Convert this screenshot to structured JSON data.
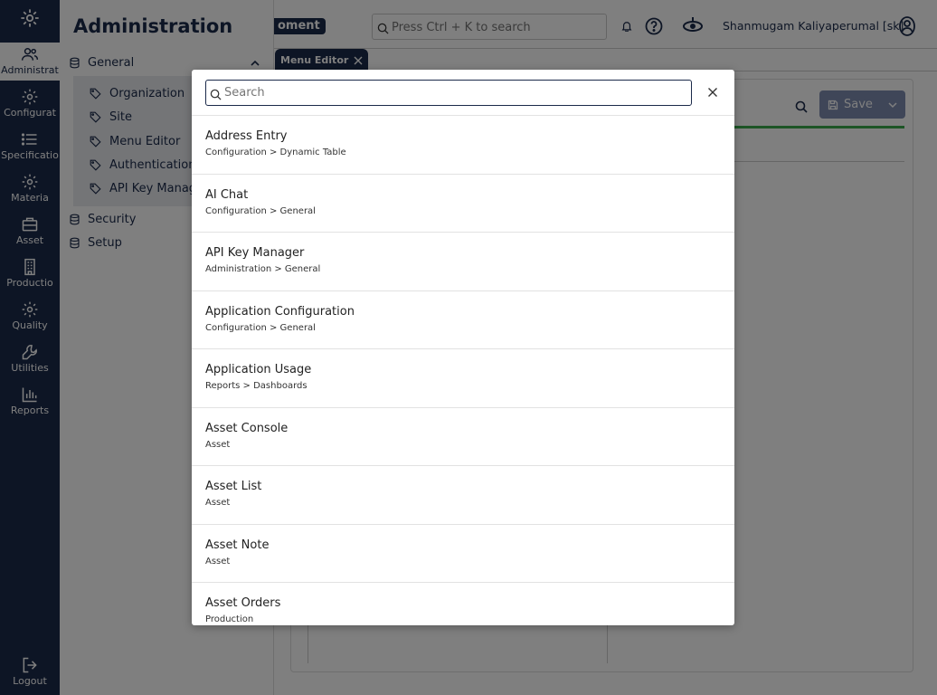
{
  "rail": {
    "items": [
      {
        "label": "Administrat",
        "icon": "users-icon"
      },
      {
        "label": "Configurat",
        "icon": "gear-icon"
      },
      {
        "label": "Specificatio",
        "icon": "list-icon"
      },
      {
        "label": "Materia",
        "icon": "gear-icon"
      },
      {
        "label": "Asset",
        "icon": "briefcase-icon"
      },
      {
        "label": "Productio",
        "icon": "building-icon"
      },
      {
        "label": "Quality",
        "icon": "gear-icon"
      },
      {
        "label": "Utilities",
        "icon": "wrench-icon"
      },
      {
        "label": "Reports",
        "icon": "bar-chart-icon"
      }
    ],
    "logout": "Logout"
  },
  "panel": {
    "title": "Administration",
    "general": "General",
    "general_items": [
      "Organization",
      "Site",
      "Menu Editor",
      "Authentication",
      "API Key Manage"
    ],
    "security": "Security",
    "setup": "Setup"
  },
  "topbar": {
    "env_badge": "oment",
    "search_placeholder": "Press Ctrl + K to search",
    "user_name": "Shanmugam Kaliyaperumal [sk]"
  },
  "tabs": [
    {
      "label": "Menu Editor"
    }
  ],
  "content": {
    "save_label": "Save"
  },
  "modal": {
    "search_placeholder": "Search",
    "results": [
      {
        "title": "Address Entry",
        "path": "Configuration > Dynamic Table"
      },
      {
        "title": "AI Chat",
        "path": "Configuration > General"
      },
      {
        "title": "API Key Manager",
        "path": "Administration > General"
      },
      {
        "title": "Application Configuration",
        "path": "Configuration > General"
      },
      {
        "title": "Application Usage",
        "path": "Reports > Dashboards"
      },
      {
        "title": "Asset Console",
        "path": "Asset"
      },
      {
        "title": "Asset List",
        "path": "Asset"
      },
      {
        "title": "Asset Note",
        "path": "Asset"
      },
      {
        "title": "Asset Orders",
        "path": "Production"
      }
    ]
  },
  "colors": {
    "navy": "#1b2a4a",
    "accent_green": "#3aaa4c",
    "save_button": "#7f8db0"
  }
}
